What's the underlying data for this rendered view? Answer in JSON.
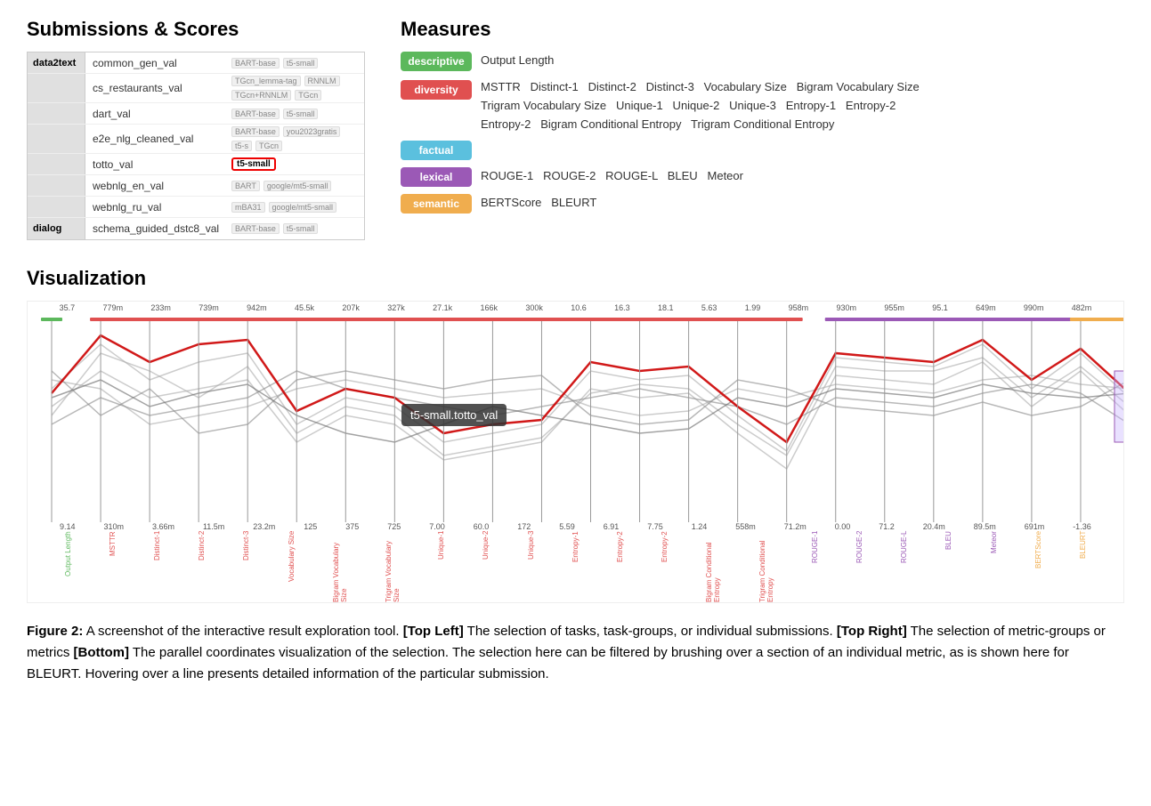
{
  "submissions": {
    "title": "Submissions & Scores",
    "groups": [
      {
        "task": "data2text",
        "entries": [
          {
            "name": "common_gen_val",
            "models": [
              "BART-base",
              "t5-small"
            ]
          },
          {
            "name": "cs_restaurants_val",
            "models": [
              "TGcn_lemma-tag",
              "RNNLM",
              "TGcn+RNNLM",
              "TGcn"
            ]
          },
          {
            "name": "dart_val",
            "models": [
              "BART-base",
              "t5-small"
            ]
          },
          {
            "name": "e2e_nlg_cleaned_val",
            "models": [
              "BART-base",
              "you2023gratis",
              "t5-s",
              "TGcn"
            ]
          },
          {
            "name": "totto_val",
            "models": [
              "t5-small"
            ],
            "highlighted": "t5-small"
          },
          {
            "name": "webnlg_en_val",
            "models": [
              "BART",
              "google/mt5-small"
            ]
          },
          {
            "name": "webnlg_ru_val",
            "models": [
              "mBA31",
              "google/mt5-small"
            ]
          }
        ]
      },
      {
        "task": "dialog",
        "entries": [
          {
            "name": "schema_guided_dstc8_val",
            "models": [
              "BART-base",
              "t5-small"
            ]
          }
        ]
      }
    ]
  },
  "measures": {
    "title": "Measures",
    "categories": [
      {
        "label": "descriptive",
        "color": "#5cb85c",
        "items": "Output Length"
      },
      {
        "label": "diversity",
        "color": "#e05050",
        "items": "MSTTR   Distinct-1   Distinct-2   Distinct-3   Vocabulary Size   Bigram Vocabulary Size\nTrigram Vocabulary Size   Unique-1   Unique-2   Unique-3   Entropy-1   Entropy-2\nEntropy-2   Bigram Conditional Entropy   Trigram Conditional Entropy"
      },
      {
        "label": "factual",
        "color": "#5bc0de",
        "items": ""
      },
      {
        "label": "lexical",
        "color": "#9b59b6",
        "items": "ROUGE-1   ROUGE-2   ROUGE-L   BLEU   Meteor"
      },
      {
        "label": "semantic",
        "color": "#f0ad4e",
        "items": "BERTScore   BLEURT"
      }
    ]
  },
  "visualization": {
    "title": "Visualization",
    "tooltip": "t5-small.totto_val",
    "top_values": [
      "35.7",
      "779m",
      "233m",
      "739m",
      "942m",
      "45.5k",
      "207k",
      "327k",
      "27.1k",
      "166k",
      "300k",
      "10.6",
      "16.3",
      "18.1",
      "5.63",
      "1.99",
      "958m",
      "930m",
      "955m",
      "95.1",
      "649m",
      "990m",
      "482m"
    ],
    "bottom_values": [
      "9.14",
      "310m",
      "3.66m",
      "11.5m",
      "23.2m",
      "125",
      "375",
      "725",
      "7.00",
      "60.0",
      "172",
      "5.59",
      "6.91",
      "7.75",
      "1.24",
      "558m",
      "71.2m",
      "0.00",
      "71.2",
      "20.4m",
      "89.5m",
      "691m",
      "-1.36"
    ],
    "axis_labels": [
      "Output Length",
      "MSTTR",
      "Distinct-1",
      "Distinct-2",
      "Distinct-3",
      "Vocabulary Size",
      "Bigram Vocabulary Size",
      "Trigram Vocabulary Size",
      "Unique-1",
      "Unique-2",
      "Unique-3",
      "Entropy-1",
      "Entropy-2",
      "Entropy-2",
      "Bigram Conditional Entropy",
      "Trigram Conditional Entropy",
      "ROUGE-1",
      "ROUGE-2",
      "ROUGE-L",
      "BLEU",
      "Meteor",
      "BERTScore",
      "BLEURT"
    ]
  },
  "caption": {
    "figure_num": "Figure 2:",
    "text": " A screenshot of the interactive result exploration tool. ",
    "bold1": "[Top Left]",
    "text2": " The selection of tasks, task-groups, or individual submissions. ",
    "bold2": "[Top Right]",
    "text3": " The selection of metric-groups or metrics ",
    "bold3": "[Bottom]",
    "text4": " The parallel coordinates visualization of the selection. The selection here can be filtered by brushing over a section of an individual metric, as is shown here for BLEURT. Hovering over a line presents detailed information of the particular submission."
  }
}
